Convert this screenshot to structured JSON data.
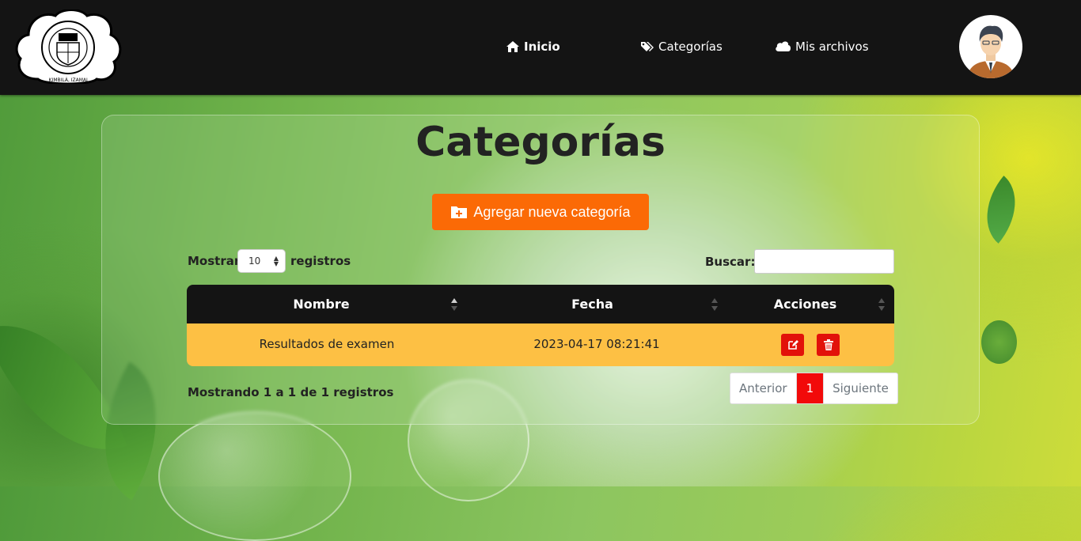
{
  "nav": {
    "logo_text_top": "DOROTEO ARTURO FERNÁNDEZ VALDÉS",
    "logo_text_bottom": "KIMBILÁ, IZAMAL",
    "links": [
      {
        "label": "Inicio",
        "icon": "home-icon"
      },
      {
        "label": "Categorías",
        "icon": "tags-icon"
      },
      {
        "label": "Mis archivos",
        "icon": "cloud-icon"
      }
    ],
    "avatar_icon": "user-avatar"
  },
  "page": {
    "title": "Categorías",
    "add_button": "Agregar nueva categoría",
    "add_icon": "folder-plus-icon"
  },
  "table_controls": {
    "show_label": "Mostrar",
    "show_value": "10",
    "show_suffix": "registros",
    "search_label": "Buscar:",
    "search_value": ""
  },
  "table": {
    "columns": [
      "Nombre",
      "Fecha",
      "Acciones"
    ],
    "rows": [
      {
        "nombre": "Resultados de examen",
        "fecha": "2023-04-17 08:21:41"
      }
    ]
  },
  "footer": {
    "info": "Mostrando 1 a 1 de 1 registros",
    "prev": "Anterior",
    "page": "1",
    "next": "Siguiente"
  },
  "colors": {
    "navbar": "#141414",
    "accent_orange": "#fb6a06",
    "row_highlight": "#fdc044",
    "danger": "#e2110a"
  }
}
